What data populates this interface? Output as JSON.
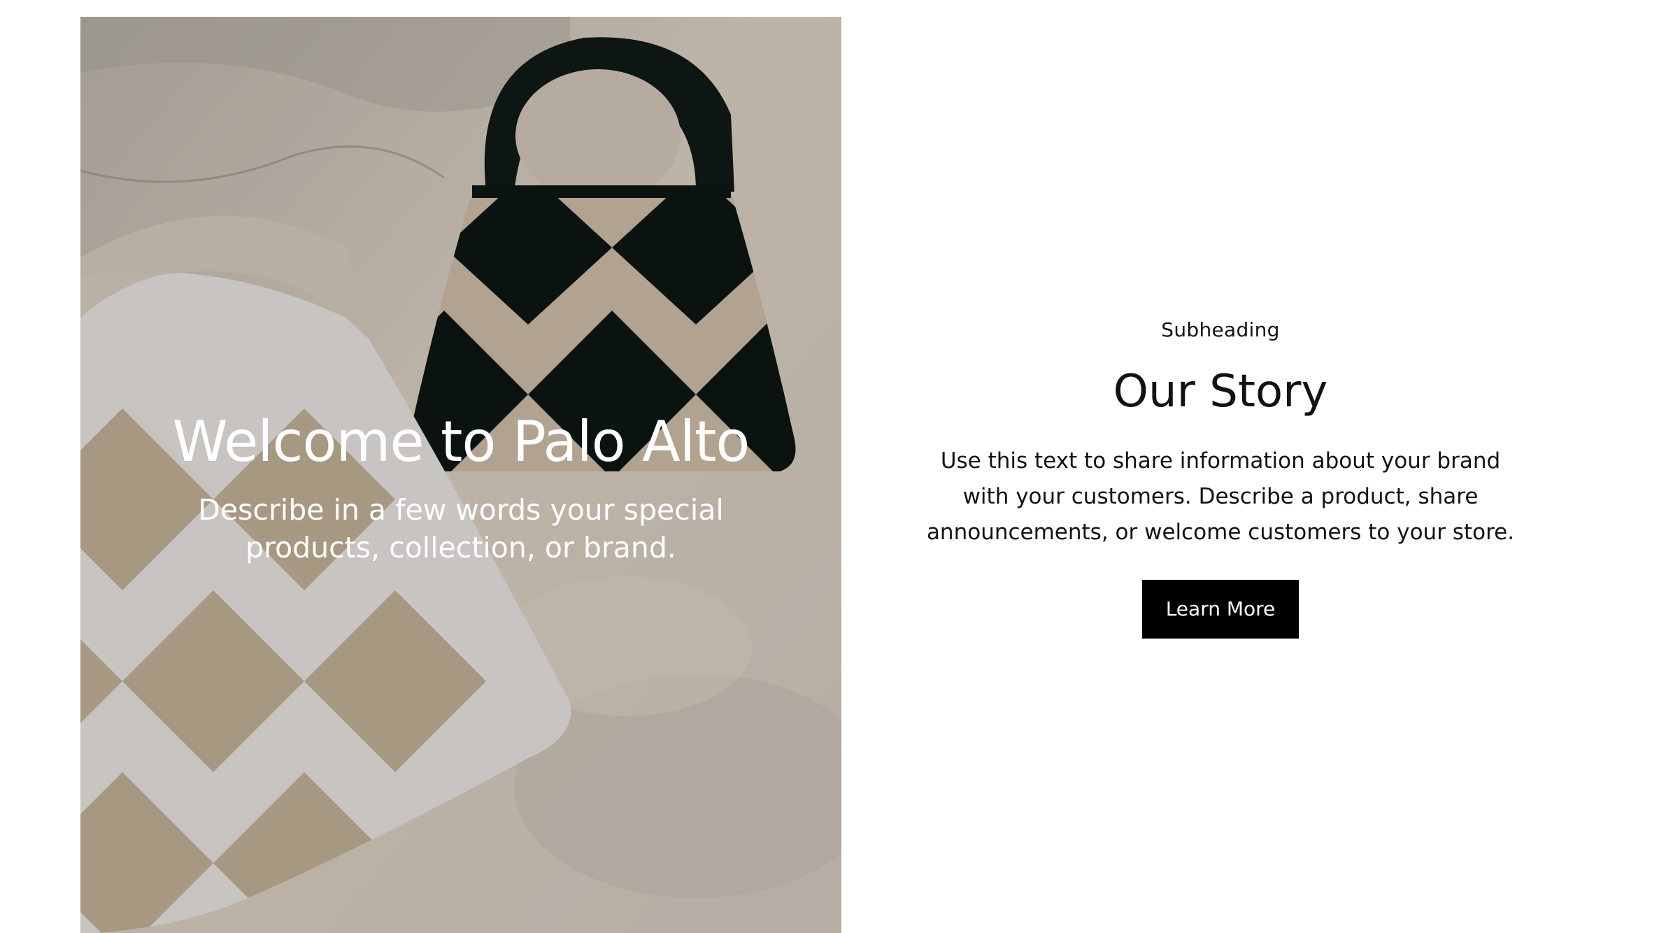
{
  "hero": {
    "image_alt": "Two checkered leather handbags resting on stone",
    "title": "Welcome to Palo Alto",
    "text": "Describe in a few words your special products, collection, or brand."
  },
  "story": {
    "subheading": "Subheading",
    "title": "Our Story",
    "text": "Use this text to share information about your brand with your customers. Describe a product, share announcements, or welcome customers to your store.",
    "button_label": "Learn More"
  },
  "colors": {
    "background": "#ffffff",
    "text": "#121212",
    "button_bg": "#000000",
    "button_text": "#ffffff",
    "hero_text": "#ffffff"
  }
}
